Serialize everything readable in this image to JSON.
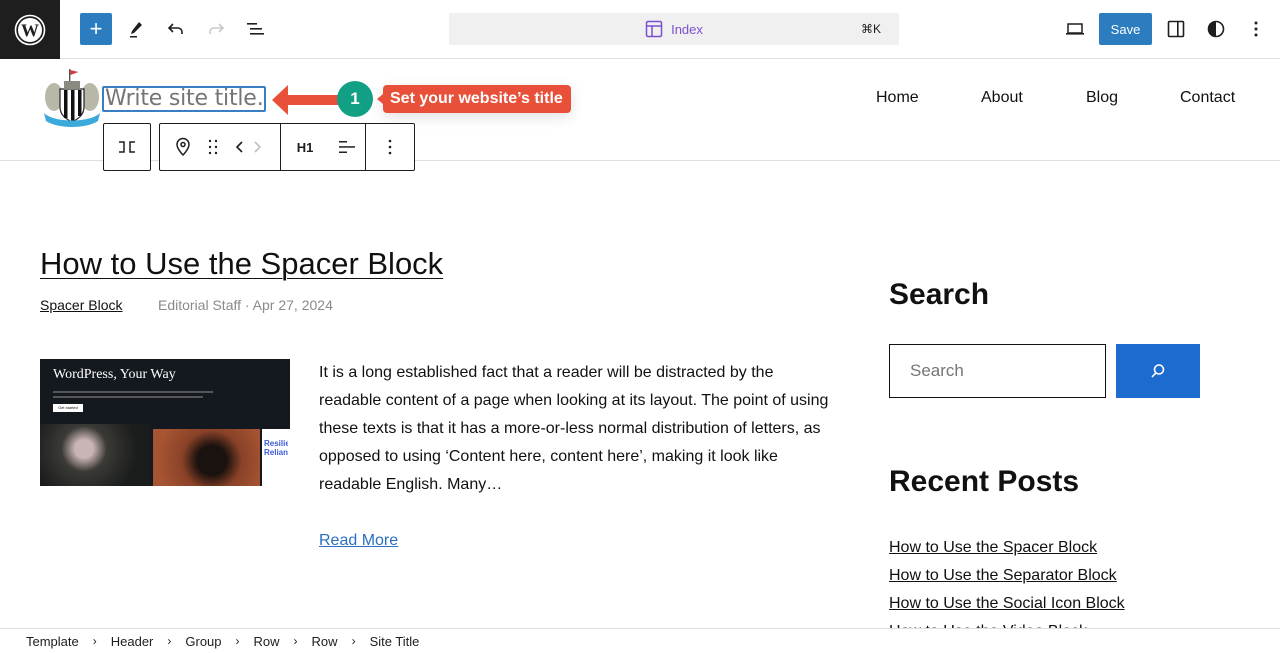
{
  "topbar": {
    "add_label": "+",
    "command_title": "Index",
    "command_shortcut": "⌘K",
    "save_label": "Save"
  },
  "header": {
    "site_title_placeholder": "Write site title…",
    "step_number": "1",
    "tooltip": "Set your website’s title",
    "nav": [
      "Home",
      "About",
      "Blog",
      "Contact"
    ],
    "block_toolbar": {
      "heading_level": "H1"
    }
  },
  "post": {
    "title": "How to Use the Spacer Block",
    "category": "Spacer Block",
    "meta": "Editorial Staff · Apr 27, 2024",
    "thumbnail": {
      "headline": "WordPress, Your Way",
      "button": "Get started",
      "side_text": "Resilie Relian"
    },
    "excerpt": "It is a long established fact that a reader will be distracted by the readable content of a page when looking at its layout. The point of using these texts is that it has a more-or-less normal distribution of letters, as opposed to using ‘Content here, content here’, making it look like readable English. Many…",
    "read_more": "Read More"
  },
  "sidebar": {
    "search_heading": "Search",
    "search_placeholder": "Search",
    "recent_heading": "Recent Posts",
    "recent_posts": [
      "How to Use the Spacer Block",
      "How to Use the Separator Block",
      "How to Use the Social Icon Block",
      "How to Use the Video Block"
    ]
  },
  "breadcrumb": [
    "Template",
    "Header",
    "Group",
    "Row",
    "Row",
    "Site Title"
  ],
  "colors": {
    "accent": "#2c7dc0",
    "step_badge": "#12a085",
    "tooltip": "#e8503a",
    "command_title": "#7b4fd1",
    "search_button": "#1e6bd0"
  }
}
